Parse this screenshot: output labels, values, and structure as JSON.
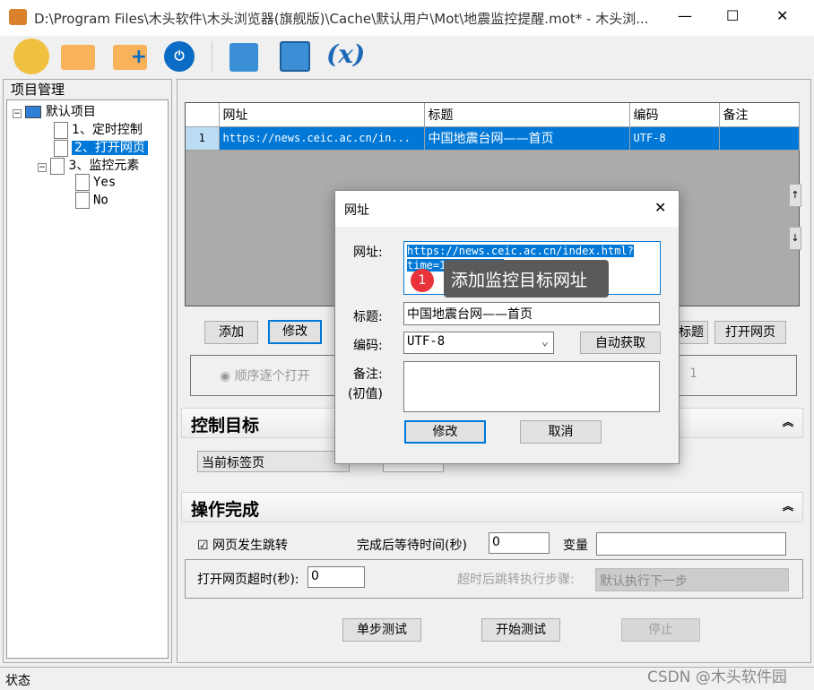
{
  "window": {
    "title": "D:\\Program Files\\木头软件\\木头浏览器(旗舰版)\\Cache\\默认用户\\Mot\\地震监控提醒.mot* - 木头浏...",
    "minimize": "—",
    "maximize": "☐",
    "close": "✕"
  },
  "toolbar": {
    "icons": [
      "new-file-icon",
      "open-folder-icon",
      "add-folder-icon",
      "power-icon",
      "save-icon",
      "save-as-icon",
      "variable-icon"
    ],
    "variable_label": "(x)"
  },
  "project": {
    "title": "项目管理",
    "root": "默认项目",
    "items": [
      "1、定时控制",
      "2、打开网页",
      "3、监控元素"
    ],
    "children": [
      "Yes",
      "No"
    ]
  },
  "grid": {
    "headers": [
      "",
      "网址",
      "标题",
      "编码",
      "备注"
    ],
    "rows": [
      [
        "1",
        "https://news.ceic.ac.cn/in...",
        "中国地震台网——首页",
        "UTF-8",
        ""
      ]
    ]
  },
  "buttons": {
    "add": "添加",
    "modify": "修改",
    "title": "标题",
    "open_page": "打开网页",
    "up": "↑",
    "down": "↓"
  },
  "open_mode": {
    "radio": "顺序逐个打开",
    "count": "1"
  },
  "control_target": {
    "title": "控制目标",
    "select": "当前标签页"
  },
  "done": {
    "title": "操作完成",
    "jump_checkbox": "网页发生跳转",
    "jump_checked": true,
    "wait_label": "完成后等待时间(秒)",
    "wait_value": "0",
    "var_label": "变量",
    "var_value": "",
    "timeout_label": "打开网页超时(秒):",
    "timeout_value": "0",
    "jump_step_label": "超时后跳转执行步骤:",
    "jump_step_value": "默认执行下一步"
  },
  "test": {
    "step": "单步测试",
    "start": "开始测试",
    "stop": "停止"
  },
  "status": {
    "label": "状态",
    "watermark": "CSDN @木头软件园"
  },
  "dialog": {
    "title": "网址",
    "url_label": "网址:",
    "url_value": "https://news.ceic.ac.cn/index.html?time=1655732788",
    "title_label": "标题:",
    "title_value": "中国地震台网——首页",
    "enc_label": "编码:",
    "enc_value": "UTF-8",
    "auto": "自动获取",
    "note_label": "备注:",
    "note_sub": "(初值)",
    "note_value": "",
    "ok": "修改",
    "cancel": "取消"
  },
  "tooltip": {
    "badge": "1",
    "text": "添加监控目标网址"
  },
  "colors": {
    "selection": "#0078d7",
    "badge": "#e8333b",
    "tooltip": "#5a5a5a"
  }
}
